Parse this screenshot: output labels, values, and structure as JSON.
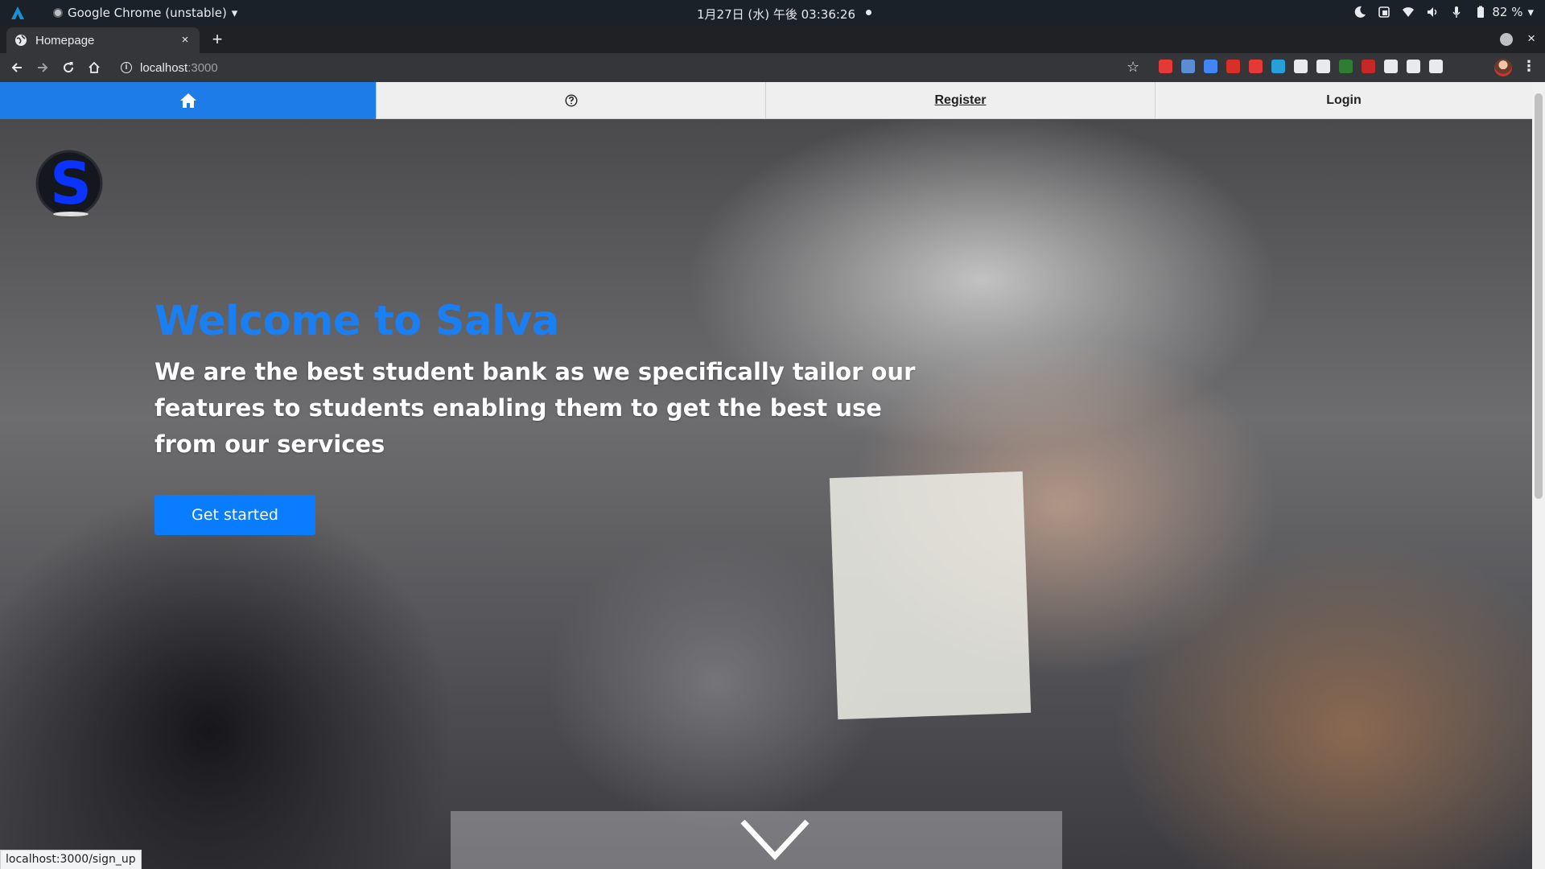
{
  "os_bar": {
    "app_name": "Google Chrome (unstable)",
    "app_menu_arrow": "▾",
    "clock": "1月27日 (水) 午後 03:36:26",
    "battery": "82 %",
    "tray_arrow": "▾",
    "icons": [
      "activities-icon",
      "night-light-icon",
      "screen-share-icon",
      "wifi-icon",
      "volume-icon",
      "microphone-icon",
      "battery-icon"
    ]
  },
  "browser": {
    "tab_title": "Homepage",
    "tab_close": "×",
    "new_tab": "+",
    "url_host": "localhost",
    "url_port": ":3000",
    "star": "☆",
    "menu": "⋮",
    "window_close": "×",
    "extension_colors": [
      "#e53935",
      "#5a8dd6",
      "#4285f4",
      "#d93025",
      "#e53935",
      "#27a0d8",
      "#e8eaed",
      "#e8eaed",
      "#2e7d32",
      "#c62828",
      "#e8eaed",
      "#e8eaed",
      "#e8eaed"
    ]
  },
  "site": {
    "nav": {
      "home_icon": "home-icon",
      "help_icon": "question-circle-icon",
      "register": "Register",
      "login": "Login"
    },
    "logo_letter": "S",
    "hero": {
      "title": "Welcome to Salva",
      "subtitle": "We are the best student bank as we specifically tailor our features to students enabling them to get the best use from our services",
      "cta": "Get started"
    },
    "colors": {
      "brand_blue": "#1a7ff2",
      "nav_active": "#1e7ce8",
      "button": "#0a7cff"
    }
  },
  "status_bar": {
    "link_url": "localhost:3000/sign_up"
  }
}
